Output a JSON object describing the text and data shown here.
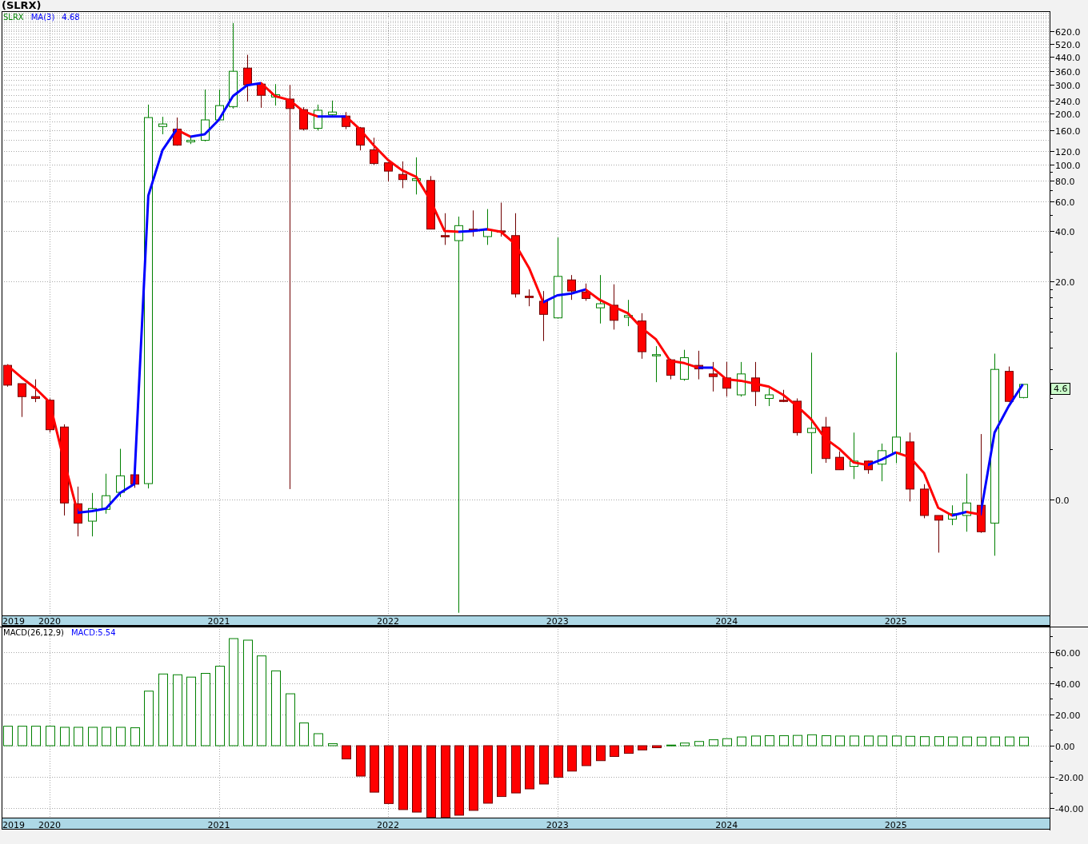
{
  "title": "(SLRX)",
  "price_panel": {
    "legend": [
      {
        "text": "SLRX",
        "color": "#008000"
      },
      {
        "text": "MA(3)",
        "color": "#0000ff"
      },
      {
        "text": "4.68",
        "color": "#0000ff"
      }
    ],
    "price_tag": "4.6",
    "axis_labels": [
      "620.0",
      "520.0",
      "440.0",
      "360.0",
      "300.0",
      "240.0",
      "200.0",
      "160.0",
      "120.0",
      "100.0",
      "80.0",
      "60.0",
      "40.0",
      "20.0",
      "0.0"
    ],
    "year_labels": [
      "2019",
      "2020",
      "2021",
      "2022",
      "2023",
      "2024",
      "2025"
    ]
  },
  "macd_panel": {
    "reading": "MACD:5.54",
    "chart_data": {
      "type": "bar",
      "grid": true,
      "ylim": [
        -46.15,
        76.4
      ],
      "categories": [
        "2019",
        null,
        null,
        "2020",
        null,
        null,
        null,
        null,
        null,
        null,
        null,
        null,
        null,
        null,
        null,
        "2021",
        null,
        null,
        null,
        null,
        null,
        null,
        null,
        null,
        null,
        null,
        null,
        "2022",
        null,
        null,
        null,
        null,
        null,
        null,
        null,
        null,
        null,
        null,
        null,
        "2023",
        null,
        null,
        null,
        null,
        null,
        null,
        null,
        null,
        null,
        null,
        null,
        "2024",
        null,
        null,
        null,
        null,
        null,
        null,
        null,
        null,
        null,
        null,
        null,
        "2025",
        null,
        null,
        null,
        null,
        null,
        null,
        null,
        null,
        null
      ],
      "yticks": [
        {
          "value": 60,
          "label": "60.00"
        },
        {
          "value": 40,
          "label": "40.00"
        },
        {
          "value": 20,
          "label": "20.00"
        },
        {
          "value": 0,
          "label": "0.00"
        },
        {
          "value": -20,
          "label": "-20.00"
        },
        {
          "value": -40,
          "label": "-40.00"
        }
      ],
      "series": [
        {
          "name": "MACD(26,12,9)",
          "values": [
            12.5,
            12.5,
            12.5,
            12.5,
            11.8,
            11.8,
            11.8,
            11.8,
            11.8,
            11.5,
            35,
            46,
            45.5,
            44,
            46.4,
            51,
            68.7,
            67.7,
            57.6,
            48,
            33.3,
            14.6,
            7.7,
            1.3,
            -8.5,
            -19.5,
            -29.8,
            -37.1,
            -41,
            -42.6,
            -46,
            -46.1,
            -44.6,
            -41.5,
            -36.9,
            -32.6,
            -30.3,
            -27.7,
            -24.6,
            -20.3,
            -16.3,
            -12.8,
            -9.6,
            -6.9,
            -4.9,
            -2.7,
            -1.3,
            0.4,
            1.7,
            2.7,
            3.8,
            4.5,
            5.6,
            6.2,
            6.4,
            6.4,
            6.6,
            7.0,
            6.4,
            6.2,
            6.2,
            6.2,
            6.2,
            6.2,
            6.0,
            5.8,
            5.8,
            5.6,
            5.6,
            5.5,
            5.6,
            5.6,
            5.5
          ]
        }
      ]
    }
  }
}
